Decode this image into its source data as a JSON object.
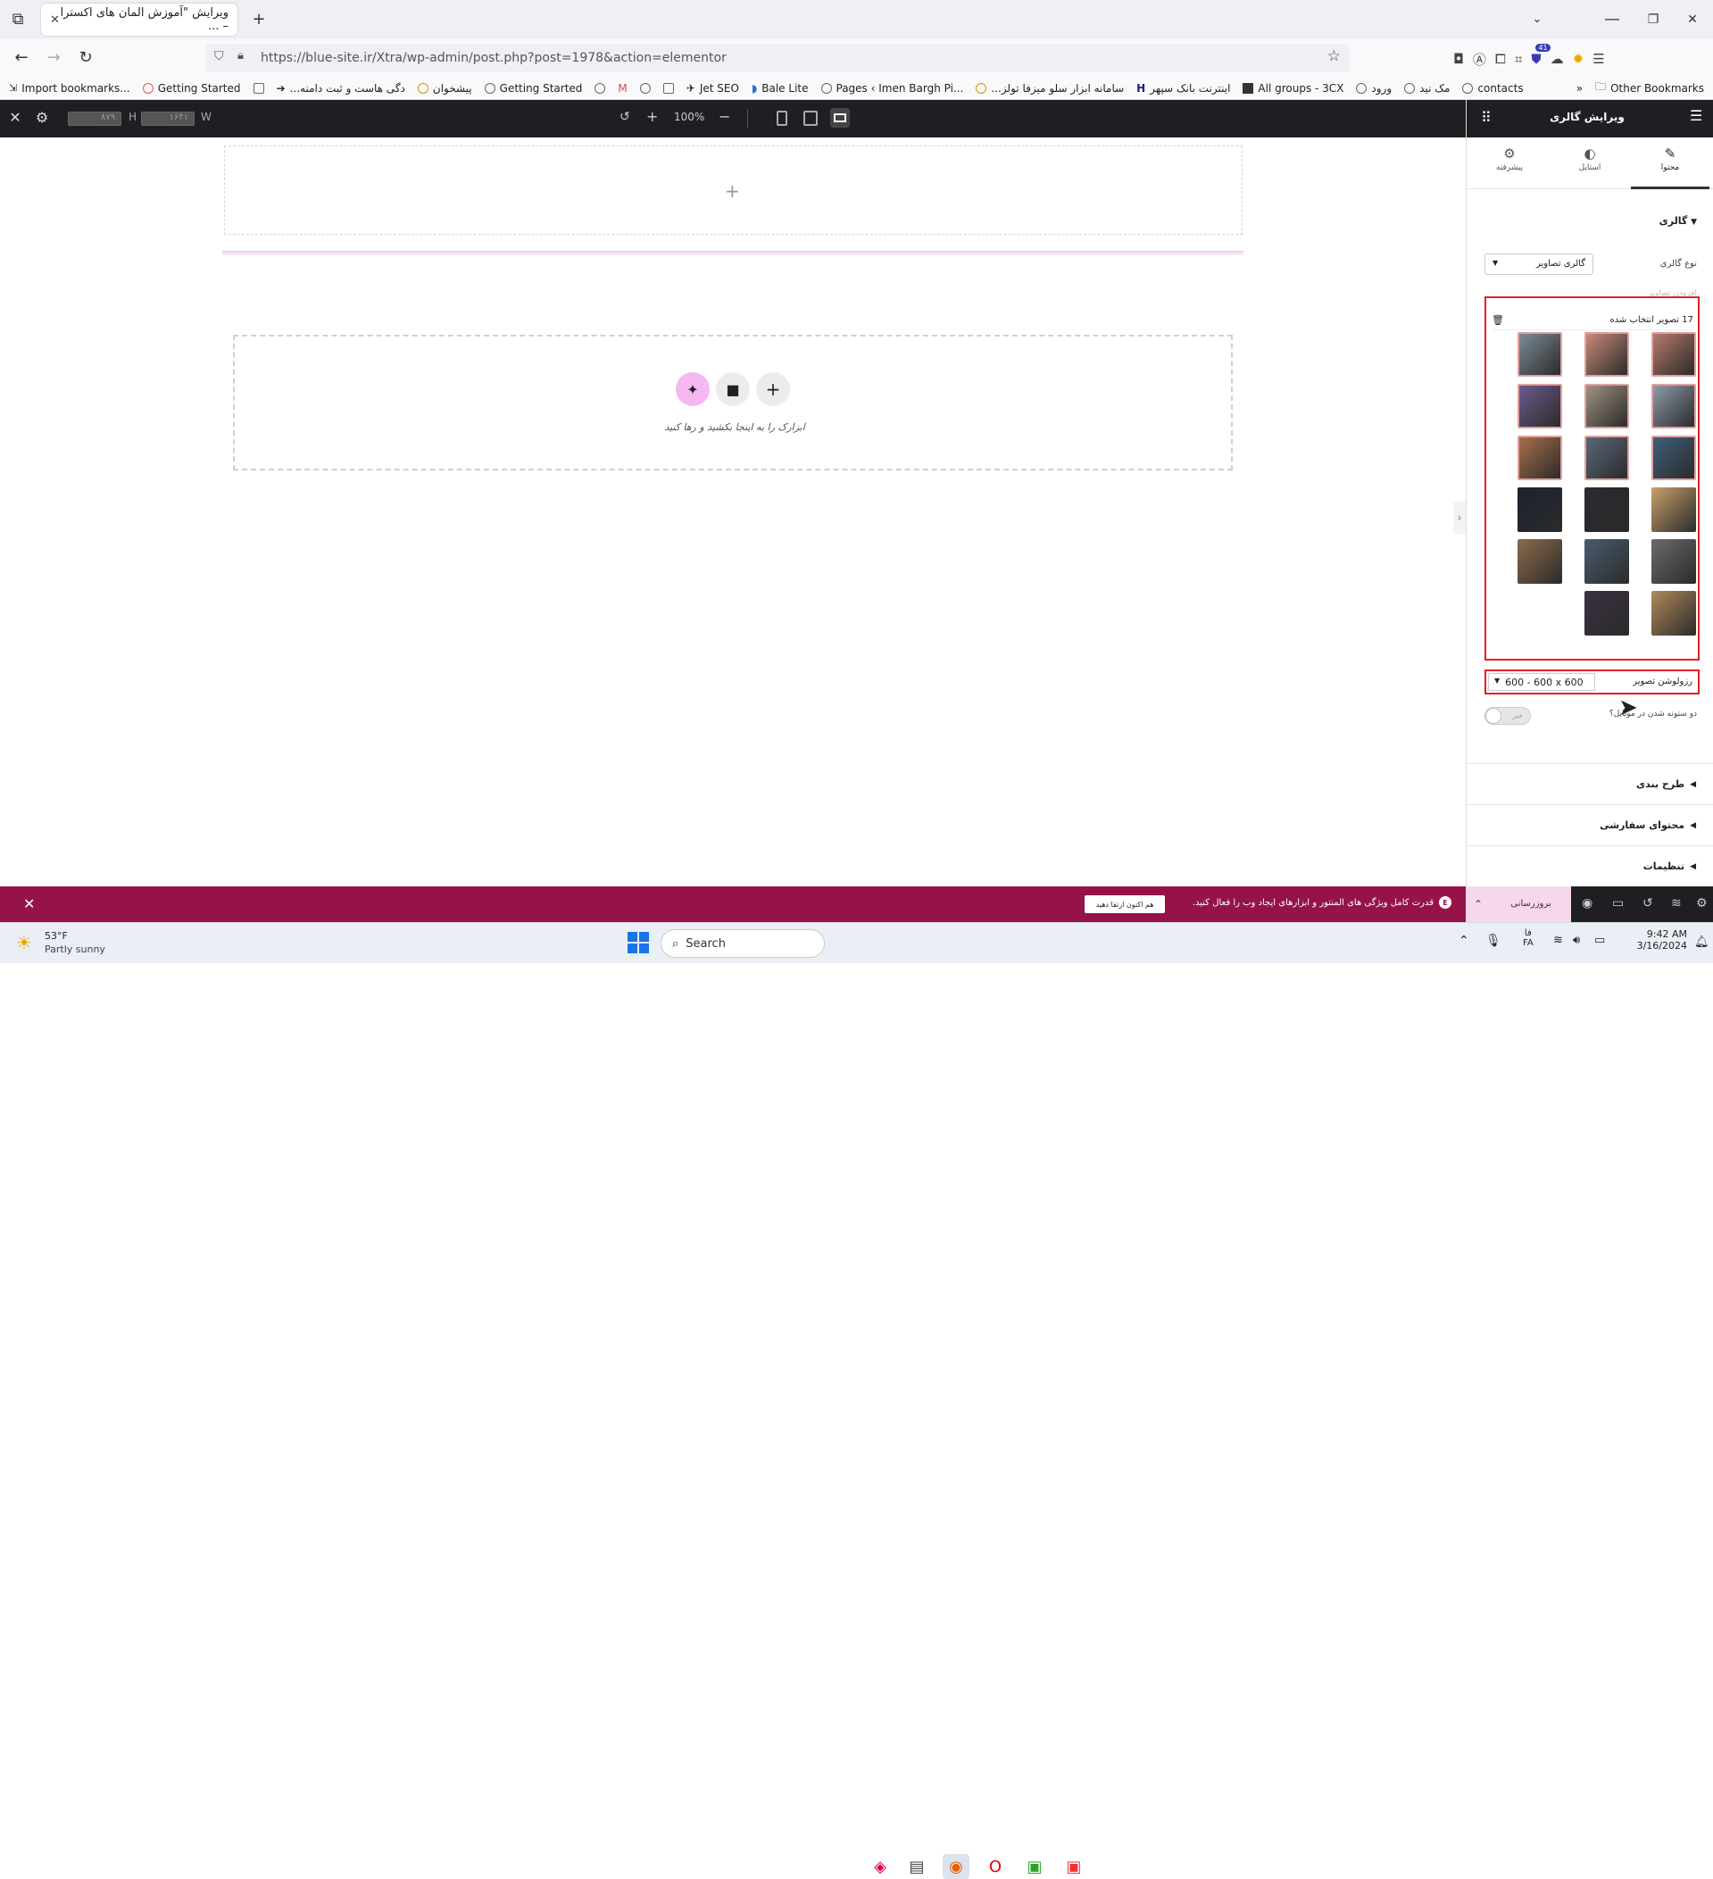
{
  "browser": {
    "tab_title": "ویرایش \"آموزش المان های اکسترا – ...",
    "new_tab_symbol": "+",
    "url": "https://blue-site.ir/Xtra/wp-admin/post.php?post=1978&action=elementor",
    "extension_badge": "41",
    "bookmarks": [
      "Import bookmarks...",
      "Getting Started",
      "...دگی هاست و ثبت دامنه",
      "پیشخوان",
      "Getting Started",
      "Jet SEO",
      "Bale Lite",
      "Pages ‹ Imen Bargh Pi...",
      "...سامانه ابزار سلو میزفا تولز",
      "اینترنت بانک سپهر",
      "All groups - 3CX",
      "ورود",
      "مک نید",
      "contacts"
    ],
    "other_bookmarks": "Other Bookmarks",
    "overflow_symbol": "»"
  },
  "editor_toolbar": {
    "width_label": "W",
    "width_value": "۱۶۴۱",
    "height_label": "H",
    "height_value": "۸۷۹",
    "zoom": "100%",
    "zoom_in_symbol": "+",
    "zoom_out_symbol": "−"
  },
  "canvas": {
    "add_section_symbol": "+",
    "drop_hint": "ابزارک را به اینجا بکشید و رها کنید"
  },
  "panel": {
    "title": "ویرایش گالری",
    "tabs": [
      {
        "label": "محتوا",
        "icon": "pencil-icon",
        "active": true
      },
      {
        "label": "استایل",
        "icon": "half-circle-icon",
        "active": false
      },
      {
        "label": "پیشرفته",
        "icon": "gear-icon",
        "active": false
      }
    ],
    "section_title": "گالری",
    "gallery_type_label": "نوع گالری",
    "gallery_type_value": "گالری تصاویر",
    "images_label": "افزودن تصاویر",
    "selected_count_text": "17 تصویر انتخاب شده",
    "resolution_label": "رزولوشن تصویر",
    "resolution_value": "600 - 600 x 600",
    "mobile_two_col_label": "دو ستونه شدن در موبایل؟",
    "toggle_off_label": "خیر",
    "collapsed_sections": [
      "طرح بندی",
      "محتوای سفارشی",
      "تنظیمات"
    ],
    "thumbnail_count": 17,
    "colors": {
      "accent": "#96134a",
      "highlight": "#e3202a"
    }
  },
  "notice": {
    "message": "قدرت کامل ویژگی های المنتور و ابزارهای ایجاد وب را فعال کنید.",
    "upgrade_button": "هم اکنون ارتقا دهید",
    "update_button": "بروزرسانی",
    "close_symbol": "✕"
  },
  "taskbar": {
    "weather_temp": "53°F",
    "weather_desc": "Partly sunny",
    "search_placeholder": "Search",
    "lang_top": "فا",
    "lang_bottom": "FA",
    "time": "9:42 AM",
    "date": "3/16/2024"
  }
}
